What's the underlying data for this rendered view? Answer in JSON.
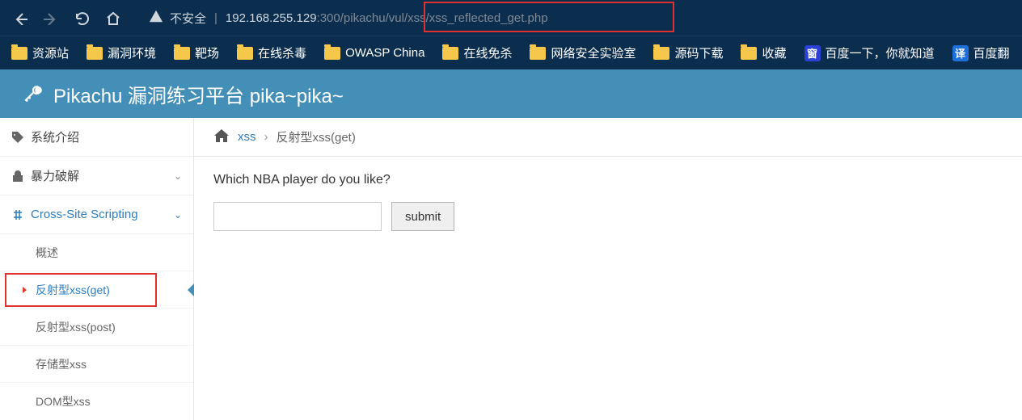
{
  "browser": {
    "insecure_label": "不安全",
    "url_ip": "192.168.255.129",
    "url_port": ":300",
    "url_path": "/pikachu/vul/xss/xss_reflected_get.php"
  },
  "bookmarks": [
    {
      "label": "资源站",
      "icon": "folder"
    },
    {
      "label": "漏洞环境",
      "icon": "folder"
    },
    {
      "label": "靶场",
      "icon": "folder"
    },
    {
      "label": "在线杀毒",
      "icon": "folder"
    },
    {
      "label": "OWASP China",
      "icon": "folder"
    },
    {
      "label": "在线免杀",
      "icon": "folder"
    },
    {
      "label": "网络安全实验室",
      "icon": "folder"
    },
    {
      "label": "源码下载",
      "icon": "folder"
    },
    {
      "label": "收藏",
      "icon": "folder"
    },
    {
      "label": "百度一下，你就知道",
      "icon": "baidu"
    },
    {
      "label": "百度翻",
      "icon": "trans"
    }
  ],
  "app": {
    "title": "Pikachu 漏洞练习平台 pika~pika~"
  },
  "sidebar": {
    "intro": "系统介绍",
    "brute": "暴力破解",
    "xss": "Cross-Site Scripting",
    "subs": {
      "overview": "概述",
      "reflected_get": "反射型xss(get)",
      "reflected_post": "反射型xss(post)",
      "stored": "存储型xss",
      "dom": "DOM型xss"
    }
  },
  "breadcrumb": {
    "cat": "xss",
    "page": "反射型xss(get)"
  },
  "content": {
    "question": "Which NBA player do you like?",
    "submit_label": "submit",
    "input_value": ""
  }
}
